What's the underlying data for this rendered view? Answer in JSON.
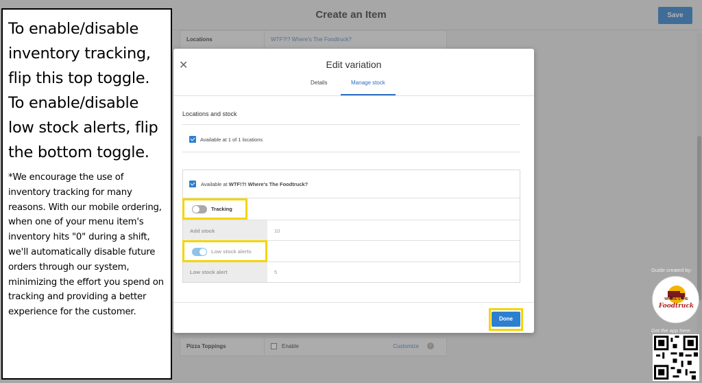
{
  "background": {
    "page_title": "Create an Item",
    "save_label": "Save",
    "rows": {
      "locations_label": "Locations",
      "locations_value": "WTF?!? Where's The Foodtruck?",
      "pizza_label": "Pizza Toppings",
      "enable_label": "Enable",
      "customize_label": "Customize"
    }
  },
  "modal": {
    "title": "Edit variation",
    "tabs": [
      {
        "label": "Details"
      },
      {
        "label": "Manage stock",
        "active": true
      }
    ],
    "section_title": "Locations and stock",
    "available_all": "Available at 1 of 1 locations",
    "available_at_prefix": "Available at ",
    "location_name": "WTF!?! Where's The Foodtruck?",
    "tracking_label": "Tracking",
    "tracking_on": false,
    "add_stock_label": "Add stock",
    "add_stock_value": "10",
    "low_stock_alerts_label": "Low stock alerts",
    "low_stock_alerts_on": true,
    "low_stock_alert_label": "Low stock alert",
    "low_stock_alert_value": "5",
    "done_label": "Done"
  },
  "instructions": {
    "main": "To enable/disable inventory tracking, flip this top toggle. To enable/disable low stock alerts, flip the bottom toggle.",
    "note": "*We encourage the use of inventory tracking for many reasons. With our mobile ordering, when one of your menu item's inventory hits \"0\" during a shift, we'll automatically disable future orders through our system, minimizing the effort you spend on tracking and providing a better experience for the customer."
  },
  "branding": {
    "guide_label": "Guide created by:",
    "logo_line1": "WHERE'S THE",
    "logo_line2": "Foodtruck",
    "getapp_label": "Get the app here:"
  },
  "colors": {
    "accent": "#2d7fd0",
    "highlight": "#f5d400"
  }
}
